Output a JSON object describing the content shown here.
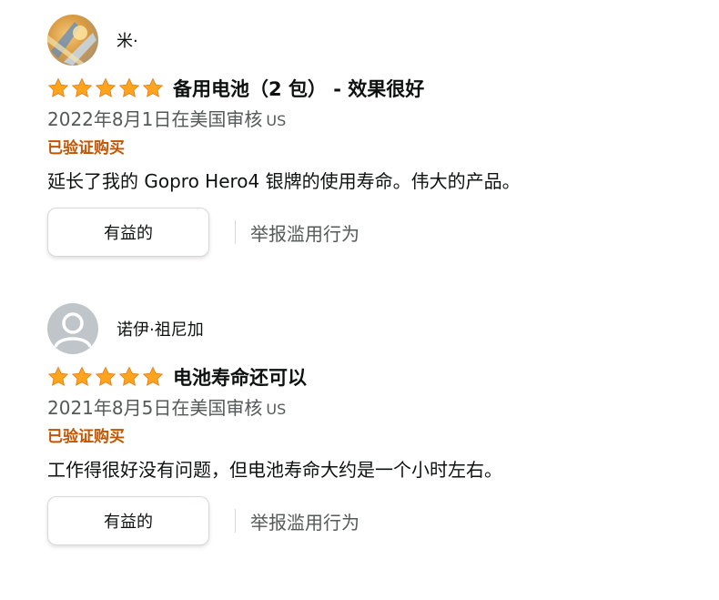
{
  "colors": {
    "star": "#ffa41c",
    "verified": "#c45500",
    "secondary_text": "#565959",
    "primary_text": "#0f1111"
  },
  "reviews": [
    {
      "author": "米·",
      "avatar": "photo-avatar",
      "rating": 5,
      "title": "备用电池（2 包） - 效果很好",
      "date": "2022年8月1日在美国审核",
      "country": "US",
      "verified": "已验证购买",
      "body": "延长了我的 Gopro Hero4 银牌的使用寿命。伟大的产品。",
      "helpful_label": "有益的",
      "report_label": "举报滥用行为"
    },
    {
      "author": "诺伊·祖尼加",
      "avatar": "default-avatar",
      "rating": 5,
      "title": "电池寿命还可以",
      "date": "2021年8月5日在美国审核",
      "country": "US",
      "verified": "已验证购买",
      "body": "工作得很好没有问题，但电池寿命大约是一个小时左右。",
      "helpful_label": "有益的",
      "report_label": "举报滥用行为"
    }
  ]
}
